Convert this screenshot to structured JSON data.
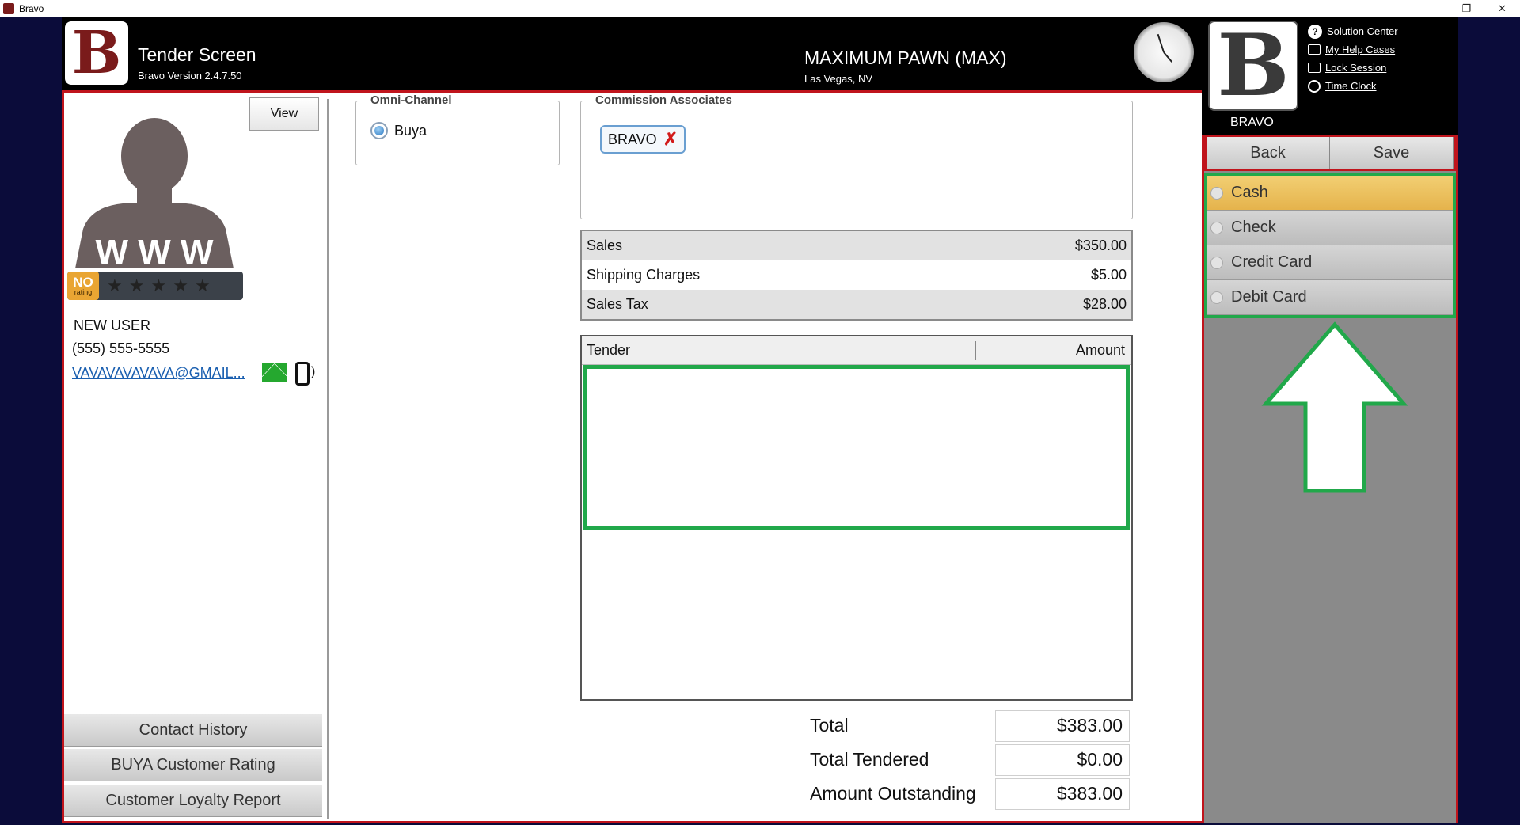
{
  "os": {
    "app_title": "Bravo",
    "minimize": "—",
    "restore": "❐",
    "close": "✕"
  },
  "header": {
    "screen_title": "Tender Screen",
    "version": "Bravo Version 2.4.7.50",
    "store_name": "MAXIMUM PAWN (MAX)",
    "store_location": "Las Vegas, NV"
  },
  "user_panel": {
    "user_name": "BRAVO",
    "links": [
      "Solution Center",
      "My Help Cases",
      "Lock Session",
      "Time Clock"
    ]
  },
  "customer": {
    "view_label": "View",
    "rating_badge": "NO",
    "rating_sub": "rating",
    "name": "NEW USER",
    "phone": "(555) 555-5555",
    "email": "VAVAVAVAVAVA@GMAIL...",
    "avatar_letters": "W W W"
  },
  "side_buttons": [
    "Contact History",
    "BUYA Customer Rating",
    "Customer Loyalty Report"
  ],
  "omni_channel": {
    "legend": "Omni-Channel",
    "option": "Buya"
  },
  "commission": {
    "legend": "Commission Associates",
    "associate": "BRAVO"
  },
  "summary": [
    {
      "label": "Sales",
      "value": "$350.00"
    },
    {
      "label": "Shipping Charges",
      "value": "$5.00"
    },
    {
      "label": "Sales Tax",
      "value": "$28.00"
    }
  ],
  "tender_table": {
    "col_tender": "Tender",
    "col_amount": "Amount"
  },
  "totals": [
    {
      "label": "Total",
      "value": "$383.00"
    },
    {
      "label": "Total Tendered",
      "value": "$0.00"
    },
    {
      "label": "Amount Outstanding",
      "value": "$383.00"
    }
  ],
  "actions": {
    "back": "Back",
    "save": "Save"
  },
  "payment_methods": [
    "Cash",
    "Check",
    "Credit Card",
    "Debit Card"
  ],
  "colors": {
    "brand": "#7a1b1b",
    "border_red": "#c0141c",
    "focus_green": "#21a84a",
    "selected": "#e5b34c"
  }
}
